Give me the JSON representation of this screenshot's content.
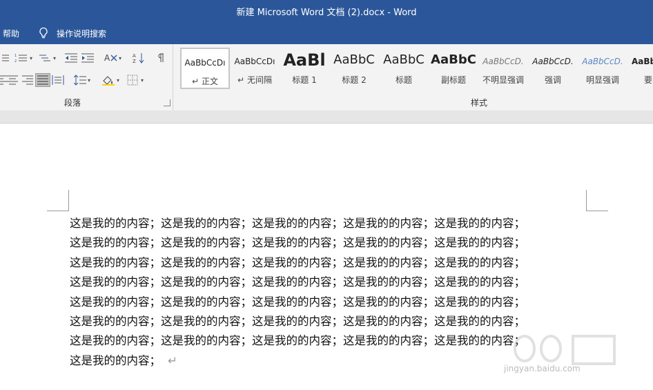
{
  "window": {
    "title": "新建 Microsoft Word 文档 (2).docx  -  Word"
  },
  "menu": {
    "help": "帮助",
    "tell_me": "操作说明搜索"
  },
  "ribbon": {
    "paragraph_label": "段落",
    "styles_label": "样式",
    "styles": [
      {
        "sample": "AaBbCcDı",
        "name": "正文",
        "prefix": "↵",
        "selected": true
      },
      {
        "sample": "AaBbCcDı",
        "name": "无间隔",
        "prefix": "↵"
      },
      {
        "sample": "AaBl",
        "name": "标题 1"
      },
      {
        "sample": "AaBbC",
        "name": "标题 2"
      },
      {
        "sample": "AaBbC",
        "name": "标题"
      },
      {
        "sample": "AaBbC",
        "name": "副标题"
      },
      {
        "sample": "AaBbCcD.",
        "name": "不明显强调"
      },
      {
        "sample": "AaBbCcD.",
        "name": "强调"
      },
      {
        "sample": "AaBbCcD.",
        "name": "明显强调"
      },
      {
        "sample": "AaBb",
        "name": "要"
      }
    ]
  },
  "document": {
    "lines": [
      "这是我的的内容；这是我的的内容；这是我的的内容；这是我的的内容；这是我的的内容；",
      "这是我的的内容；这是我的的内容；这是我的的内容；这是我的的内容；这是我的的内容；",
      "这是我的的内容；这是我的的内容；这是我的的内容；这是我的的内容；这是我的的内容；",
      "这是我的的内容；这是我的的内容；这是我的的内容；这是我的的内容；这是我的的内容；",
      "这是我的的内容；这是我的的内容；这是我的的内容；这是我的的内容；这是我的的内容；",
      "这是我的的内容；这是我的的内容；这是我的的内容；这是我的的内容；这是我的的内容；",
      "这是我的的内容；这是我的的内容；这是我的的内容；这是我的的内容；这是我的的内容；",
      "这是我的的内容；"
    ],
    "paragraph_mark": "↵"
  },
  "watermark": {
    "text": "jingyan.baidu.com"
  },
  "colors": {
    "titlebar": "#2b579a",
    "ribbon": "#f3f3f3"
  }
}
